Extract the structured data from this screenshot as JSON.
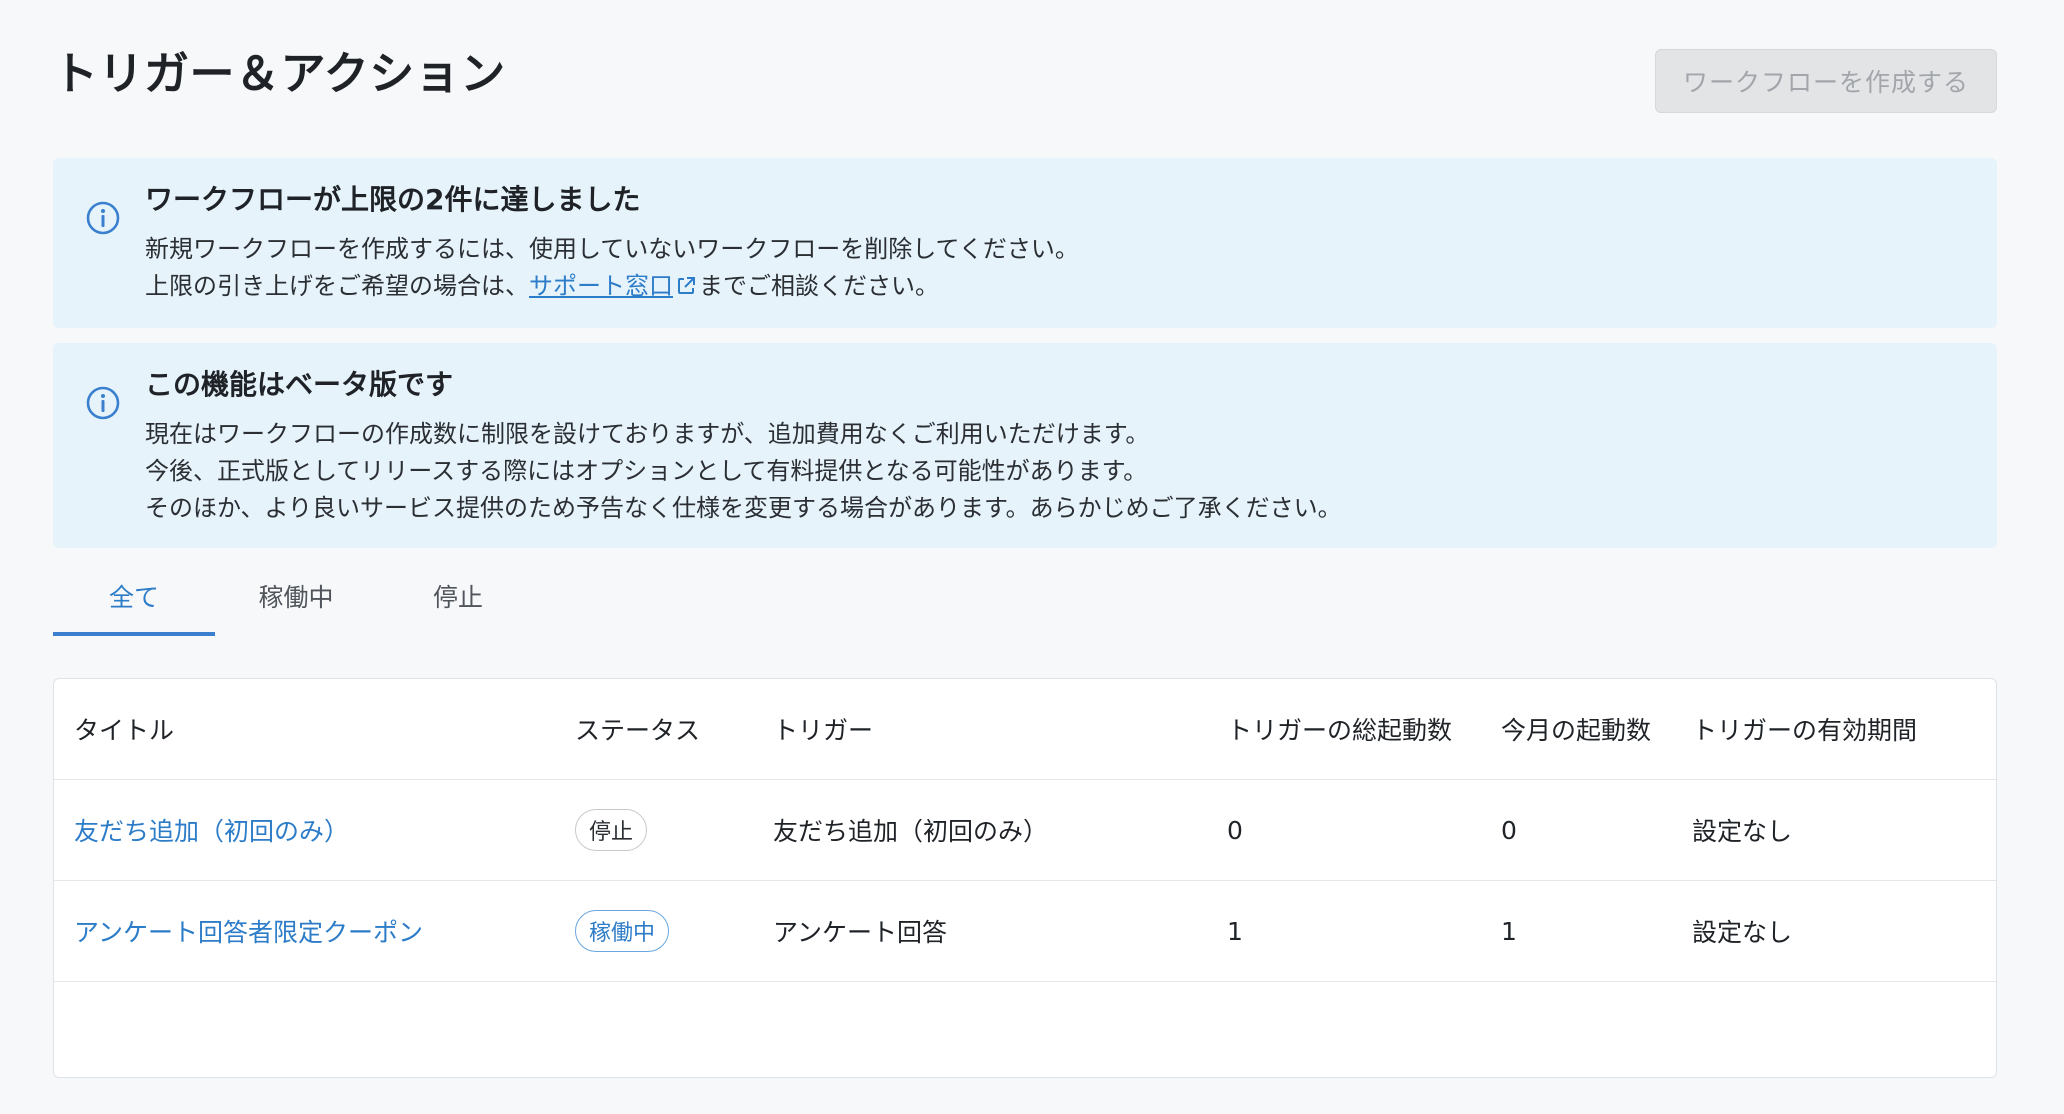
{
  "header": {
    "title": "トリガー＆アクション",
    "create_button_label": "ワークフローを作成する"
  },
  "notices": {
    "limit": {
      "title": "ワークフローが上限の2件に達しました",
      "line1": "新規ワークフローを作成するには、使用していないワークフローを削除してください。",
      "line2_prefix": "上限の引き上げをご希望の場合は、",
      "line2_link": "サポート窓口",
      "line2_suffix": "までご相談ください。"
    },
    "beta": {
      "title": "この機能はベータ版です",
      "line1": "現在はワークフローの作成数に制限を設けておりますが、追加費用なくご利用いただけます。",
      "line2": "今後、正式版としてリリースする際にはオプションとして有料提供となる可能性があります。",
      "line3": "そのほか、より良いサービス提供のため予告なく仕様を変更する場合があります。あらかじめご了承ください。"
    }
  },
  "tabs": {
    "all": "全て",
    "active": "稼働中",
    "stopped": "停止",
    "selected": "全て"
  },
  "table": {
    "columns": [
      "タイトル",
      "ステータス",
      "トリガー",
      "トリガーの総起動数",
      "今月の起動数",
      "トリガーの有効期間"
    ],
    "rows": [
      {
        "title": "友だち追加（初回のみ）",
        "status": "停止",
        "trigger": "友だち追加（初回のみ）",
        "total_runs": "0",
        "month_runs": "0",
        "period": "設定なし"
      },
      {
        "title": "アンケート回答者限定クーポン",
        "status": "稼働中",
        "trigger": "アンケート回答",
        "total_runs": "1",
        "month_runs": "1",
        "period": "設定なし"
      }
    ]
  },
  "colors": {
    "accent": "#2d7cc8",
    "notice_bg": "#e6f3fb",
    "page_bg": "#f7f8fa",
    "disabled_button_bg": "#e3e4e6"
  },
  "icons": {
    "notice": "info-circle-icon",
    "link": "external-link-icon"
  }
}
